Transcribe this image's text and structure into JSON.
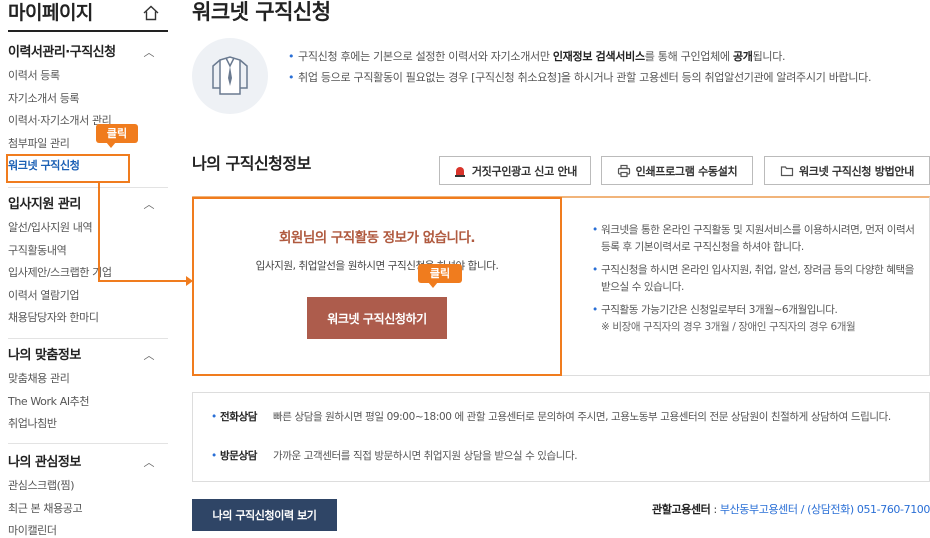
{
  "sidebar": {
    "title": "마이페이지",
    "groups": [
      {
        "title": "이력서관리·구직신청",
        "items": [
          "이력서 등록",
          "자기소개서 등록",
          "이력서·자기소개서 관리",
          "첨부파일 관리",
          "워크넷 구직신청"
        ]
      },
      {
        "title": "입사지원 관리",
        "items": [
          "알선/입사지원 내역",
          "구직활동내역",
          "입사제안/스크랩한 기업",
          "이력서 열람기업",
          "채용담당자와 한마디"
        ]
      },
      {
        "title": "나의 맞춤정보",
        "items": [
          "맞춤채용 관리",
          "The Work AI추천",
          "취업나침반"
        ]
      },
      {
        "title": "나의 관심정보",
        "items": [
          "관심스크랩(찜)",
          "최근 본 채용공고",
          "마이캘린더"
        ]
      }
    ]
  },
  "annotations": {
    "click_label": "클릭"
  },
  "page": {
    "title": "워크넷 구직신청"
  },
  "intro": {
    "line1_a": "구직신청 후에는 기본으로 설정한 이력서와 자기소개서만 ",
    "line1_b": "인재정보 검색서비스",
    "line1_c": "를 통해 구인업체에 ",
    "line1_d": "공개",
    "line1_e": "됩니다.",
    "line2": "취업 등으로 구직활동이 필요없는 경우 [구직신청 취소요청]을 하시거나 관할 고용센터 등의 취업알선기관에 알려주시기 바랍니다."
  },
  "section": {
    "title": "나의 구직신청정보",
    "buttons": [
      "거짓구인광고 신고 안내",
      "인쇄프로그램 수동설치",
      "워크넷 구직신청 방법안내"
    ]
  },
  "nodata": {
    "title": "회원님의 구직활동 정보가 없습니다.",
    "desc": "입사지원, 취업알선을 원하시면 구직신청을 하셔야 합니다.",
    "button": "워크넷 구직신청하기"
  },
  "guide": [
    "워크넷을 통한 온라인 구직활동 및 지원서비스를 이용하시려면, 먼저 이력서 등록 후 기본이력서로 구직신청을 하셔야 합니다.",
    "구직신청을 하시면 온라인 입사지원, 취업, 알선, 장려금 등의 다양한 혜택을 받으실 수 있습니다.",
    "구직활동 가능기간은 신청일로부터 3개월~6개월입니다."
  ],
  "guide_note": "※ 비장애 구직자의 경우 3개월 / 장애인 구직자의 경우 6개월",
  "consult": [
    {
      "label": "전화상담",
      "text": "빠른 상담을 원하시면 평일 09:00~18:00 에 관할 고용센터로 문의하여 주시면, 고용노동부 고용센터의 전문 상담원이 친절하게 상담하여 드립니다."
    },
    {
      "label": "방문상담",
      "text": "가까운 고객센터를 직접 방문하시면 취업지원 상담을 받으실 수 있습니다."
    }
  ],
  "footer": {
    "history_button": "나의 구직신청이력 보기",
    "center_label": "관할고용센터",
    "center_sep": " : ",
    "center_value": "부산동부고용센터 / (상담전화) 051-760-7100"
  }
}
